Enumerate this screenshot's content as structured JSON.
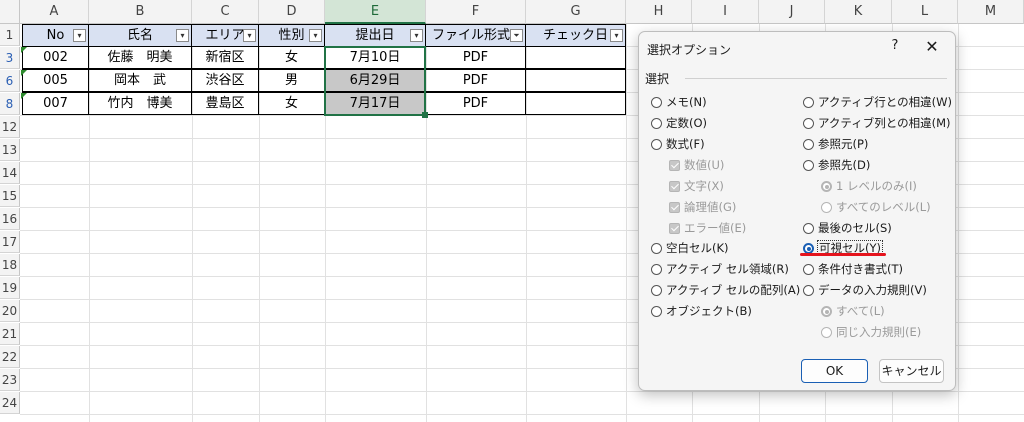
{
  "columns": [
    "A",
    "B",
    "C",
    "D",
    "E",
    "F",
    "G",
    "H",
    "I",
    "J",
    "K",
    "L",
    "M"
  ],
  "rows": [
    "1",
    "3",
    "6",
    "8",
    "12",
    "13",
    "14",
    "15",
    "16",
    "17",
    "18",
    "19",
    "20",
    "21",
    "22",
    "23",
    "24"
  ],
  "table": {
    "headers": [
      "No",
      "氏名",
      "エリア",
      "性別",
      "提出日",
      "ファイル形式",
      "チェック日"
    ],
    "data": [
      [
        "002",
        "佐藤　明美",
        "新宿区",
        "女",
        "7月10日",
        "PDF",
        ""
      ],
      [
        "005",
        "岡本　武",
        "渋谷区",
        "男",
        "6月29日",
        "PDF",
        ""
      ],
      [
        "007",
        "竹内　博美",
        "豊島区",
        "女",
        "7月17日",
        "PDF",
        ""
      ]
    ],
    "filter_icon": "dropdown-arrow-icon",
    "filter_active_icon": "filter-funnel-icon"
  },
  "dialog": {
    "title": "選択オプション",
    "help": "?",
    "close": "✕",
    "group": "選択",
    "left_options": [
      {
        "label": "メモ(N)",
        "checked": false
      },
      {
        "label": "定数(O)",
        "checked": false
      },
      {
        "label": "数式(F)",
        "checked": false
      }
    ],
    "formula_sub": [
      "数値(U)",
      "文字(X)",
      "論理値(G)",
      "エラー値(E)"
    ],
    "left_options2": [
      {
        "label": "空白セル(K)",
        "checked": false
      },
      {
        "label": "アクティブ セル領域(R)",
        "checked": false
      },
      {
        "label": "アクティブ セルの配列(A)",
        "checked": false
      },
      {
        "label": "オブジェクト(B)",
        "checked": false
      }
    ],
    "right_options": [
      {
        "label": "アクティブ行との相違(W)",
        "checked": false
      },
      {
        "label": "アクティブ列との相違(M)",
        "checked": false
      },
      {
        "label": "参照元(P)",
        "checked": false
      },
      {
        "label": "参照先(D)",
        "checked": false
      }
    ],
    "ref_sub": [
      "1 レベルのみ(I)",
      "すべてのレベル(L)"
    ],
    "right_options2": [
      {
        "label": "最後のセル(S)",
        "checked": false
      },
      {
        "label": "可視セル(Y)",
        "checked": true
      },
      {
        "label": "条件付き書式(T)",
        "checked": false
      },
      {
        "label": "データの入力規則(V)",
        "checked": false
      }
    ],
    "valid_sub": [
      "すべて(L)",
      "同じ入力規則(E)"
    ],
    "ok": "OK",
    "cancel": "キャンセル"
  },
  "colors": {
    "accent": "#1a5fb4",
    "header_fill": "#d9e1f2",
    "hidden_fill": "#c8c8c8",
    "annotation": "#e5141d"
  }
}
